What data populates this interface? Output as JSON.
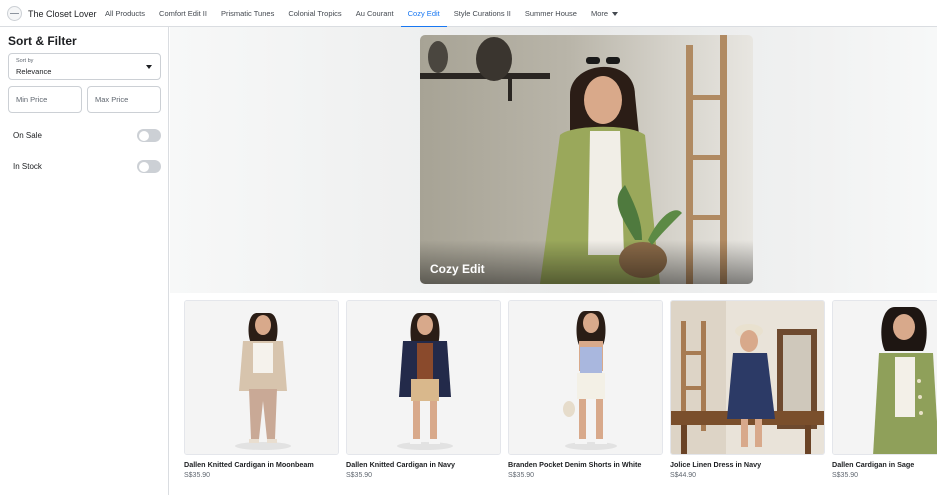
{
  "shop": {
    "name": "The Closet Lover"
  },
  "nav": {
    "tabs": [
      {
        "label": "All Products",
        "active": false
      },
      {
        "label": "Comfort Edit II",
        "active": false
      },
      {
        "label": "Prismatic Tunes",
        "active": false
      },
      {
        "label": "Colonial Tropics",
        "active": false
      },
      {
        "label": "Au Courant",
        "active": false
      },
      {
        "label": "Cozy Edit",
        "active": true
      },
      {
        "label": "Style Curations II",
        "active": false
      },
      {
        "label": "Summer House",
        "active": false
      }
    ],
    "more_label": "More",
    "accent_color": "#1877f2"
  },
  "sidebar": {
    "title": "Sort & Filter",
    "sort": {
      "caption": "Sort by",
      "value": "Relevance"
    },
    "min_price_placeholder": "Min Price",
    "max_price_placeholder": "Max Price",
    "on_sale": {
      "label": "On Sale",
      "enabled": false
    },
    "in_stock": {
      "label": "In Stock",
      "enabled": false
    }
  },
  "hero": {
    "title": "Cozy Edit"
  },
  "products": [
    {
      "name": "Dallen Knitted Cardigan in Moonbeam",
      "price": "S$35.90"
    },
    {
      "name": "Dallen Knitted Cardigan in Navy",
      "price": "S$35.90"
    },
    {
      "name": "Branden Pocket Denim Shorts in White",
      "price": "S$35.90"
    },
    {
      "name": "Jolice Linen Dress in Navy",
      "price": "S$44.90"
    },
    {
      "name": "Dallen Cardigan in Sage",
      "price": "S$35.90"
    }
  ]
}
